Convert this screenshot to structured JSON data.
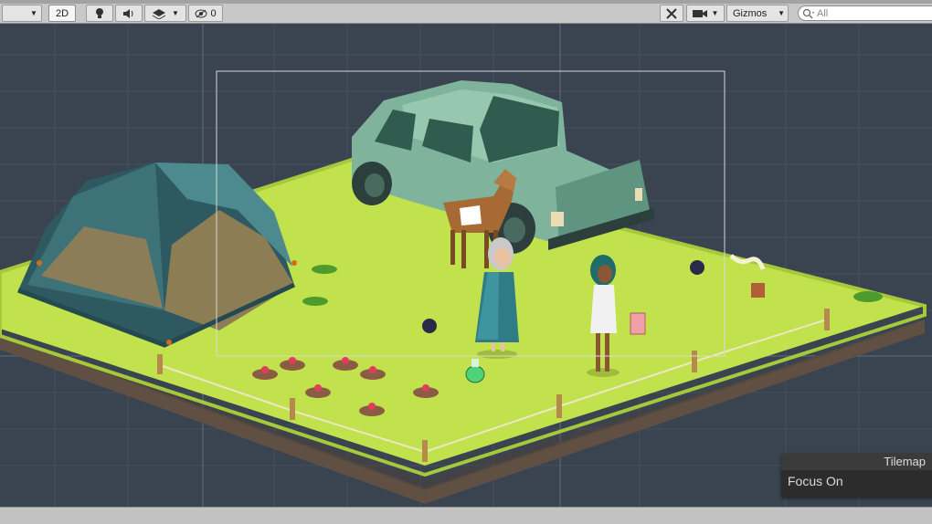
{
  "toolbar": {
    "mode_2d": "2D",
    "hidden_count": "0",
    "gizmos_label": "Gizmos",
    "search_placeholder": "All"
  },
  "overlay": {
    "title": "Tilemap",
    "focus_label": "Focus On"
  },
  "colors": {
    "background": "#3a4350",
    "grass": "#c1e24d",
    "earth": "#5f5043",
    "tent": "#3d6c74",
    "car": "#7fb39b"
  }
}
